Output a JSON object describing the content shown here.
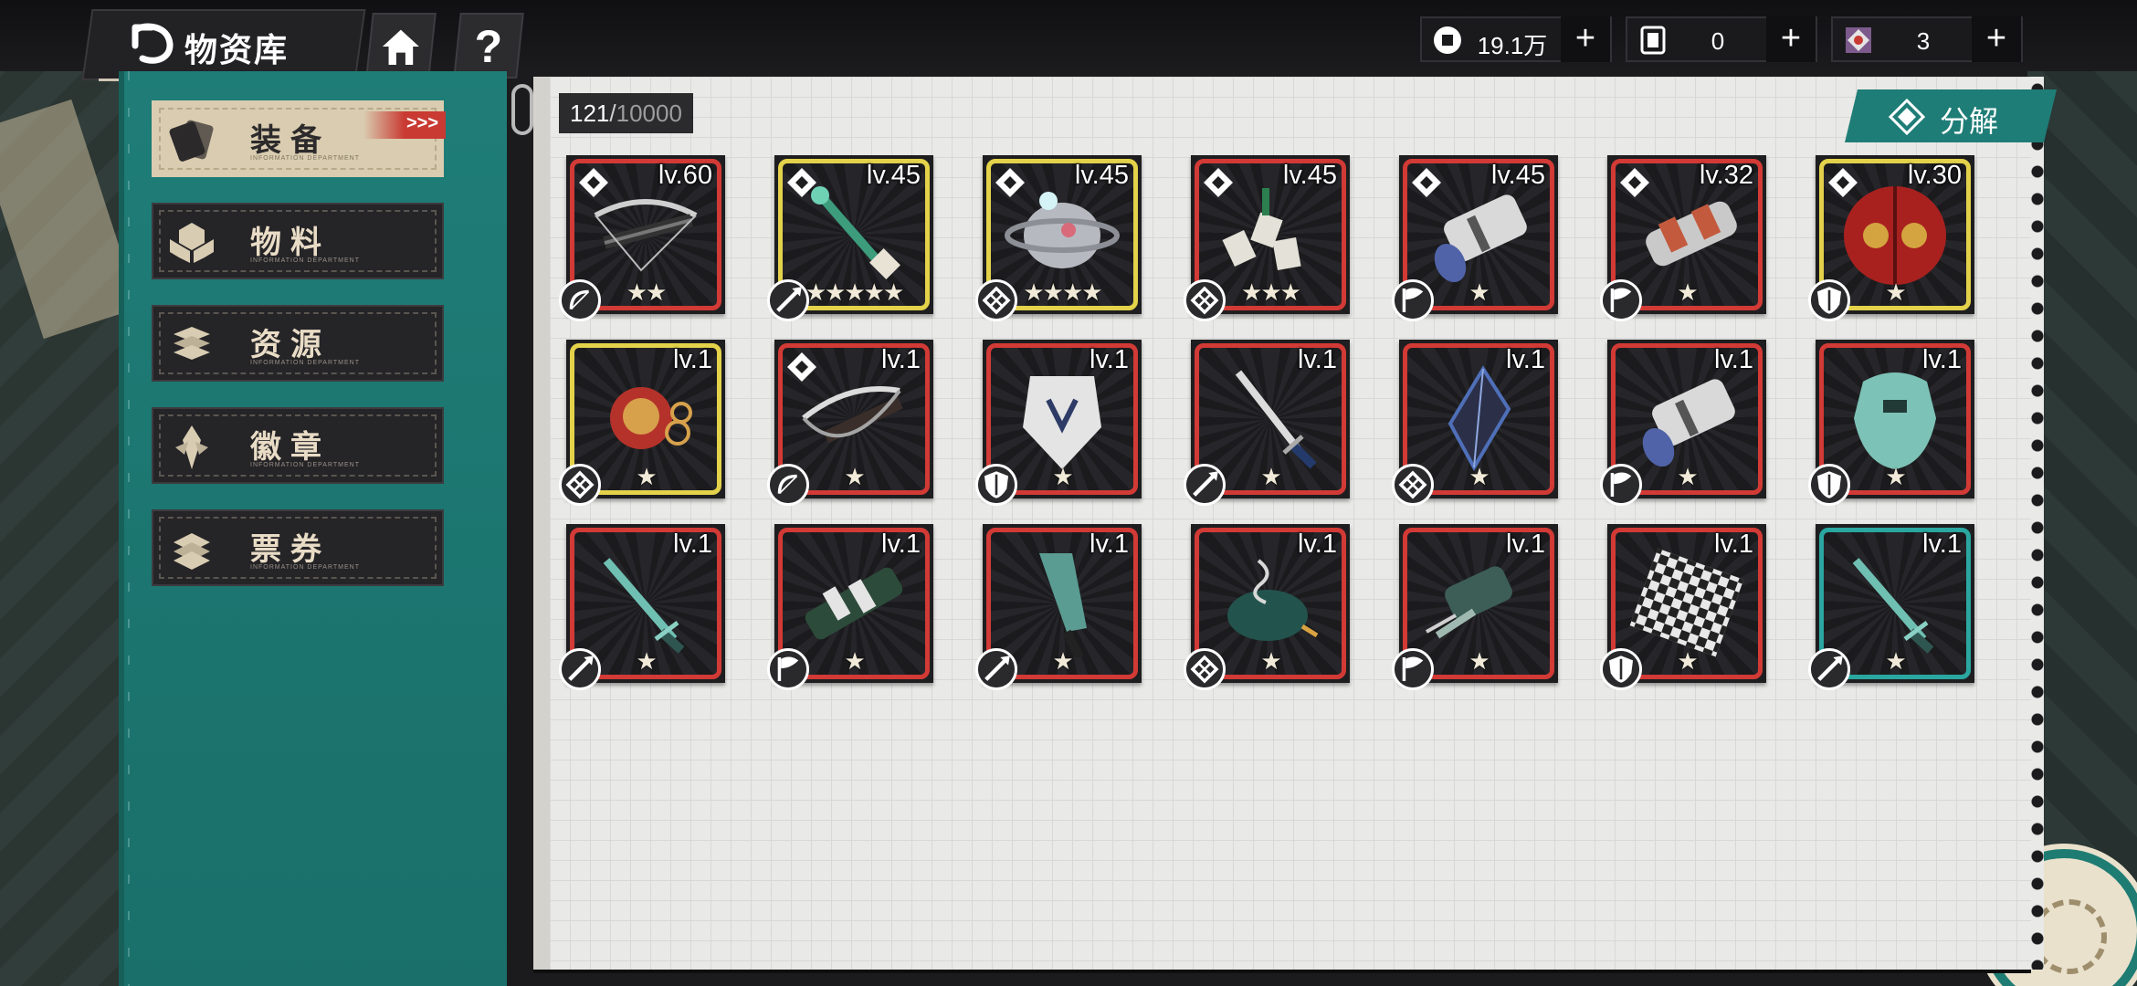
{
  "header": {
    "title": "物资库",
    "icons": {
      "back": "back-arrow-icon",
      "home": "home-icon",
      "help": "question-mark-icon"
    }
  },
  "currencies": [
    {
      "name": "coin",
      "icon": "coin-icon",
      "value": "19.1万",
      "plus": "+"
    },
    {
      "name": "ticket",
      "icon": "card-icon",
      "value": "0",
      "plus": "+"
    },
    {
      "name": "gem",
      "icon": "gem-icon",
      "value": "3",
      "plus": "+"
    }
  ],
  "sidebar": {
    "items": [
      {
        "label": "装备",
        "sub": "INFORMATION DEPARTMENT",
        "icon": "equipment-icon",
        "active": true,
        "flag": ">>>"
      },
      {
        "label": "物料",
        "sub": "INFORMATION DEPARTMENT",
        "icon": "materials-icon",
        "active": false
      },
      {
        "label": "资源",
        "sub": "INFORMATION DEPARTMENT",
        "icon": "resources-icon",
        "active": false
      },
      {
        "label": "徽章",
        "sub": "INFORMATION DEPARTMENT",
        "icon": "badge-icon",
        "active": false
      },
      {
        "label": "票券",
        "sub": "INFORMATION DEPARTMENT",
        "icon": "tickets-icon",
        "active": false
      }
    ]
  },
  "inventory": {
    "count": "121",
    "separator": "/",
    "max": "10000",
    "decompose_label": "分解",
    "decompose_icon": "decompose-icon"
  },
  "items": [
    {
      "level": "lv.60",
      "stars": "★★",
      "rarity": "#d23a36",
      "type": "bow-icon",
      "sprite": "crossbow",
      "badge": true
    },
    {
      "level": "lv.45",
      "stars": "★★★★★",
      "rarity": "#e3d24a",
      "type": "spear-icon",
      "sprite": "staff",
      "badge": true
    },
    {
      "level": "lv.45",
      "stars": "★★★★",
      "rarity": "#e3d24a",
      "type": "knot-icon",
      "sprite": "orb",
      "badge": true
    },
    {
      "level": "lv.45",
      "stars": "★★★",
      "rarity": "#d23a36",
      "type": "knot-icon",
      "sprite": "mahjong",
      "badge": true
    },
    {
      "level": "lv.45",
      "stars": "★",
      "rarity": "#d23a36",
      "type": "flag-icon",
      "sprite": "cannon",
      "badge": true
    },
    {
      "level": "lv.32",
      "stars": "★",
      "rarity": "#d23a36",
      "type": "flag-icon",
      "sprite": "rocket",
      "badge": true
    },
    {
      "level": "lv.30",
      "stars": "★",
      "rarity": "#e3d24a",
      "type": "shield-icon",
      "sprite": "door-shield",
      "badge": true
    },
    {
      "level": "lv.1",
      "stars": "★",
      "rarity": "#e3d24a",
      "type": "knot-icon",
      "sprite": "lion-ring",
      "badge": false
    },
    {
      "level": "lv.1",
      "stars": "★",
      "rarity": "#d23a36",
      "type": "bow-icon",
      "sprite": "crossbow2",
      "badge": true
    },
    {
      "level": "lv.1",
      "stars": "★",
      "rarity": "#d23a36",
      "type": "shield-icon",
      "sprite": "plate-shield",
      "badge": false
    },
    {
      "level": "lv.1",
      "stars": "★",
      "rarity": "#d23a36",
      "type": "spear-icon",
      "sprite": "sword",
      "badge": false
    },
    {
      "level": "lv.1",
      "stars": "★",
      "rarity": "#d23a36",
      "type": "knot-icon",
      "sprite": "diamond",
      "badge": false
    },
    {
      "level": "lv.1",
      "stars": "★",
      "rarity": "#d23a36",
      "type": "flag-icon",
      "sprite": "cannon",
      "badge": false
    },
    {
      "level": "lv.1",
      "stars": "★",
      "rarity": "#d23a36",
      "type": "shield-icon",
      "sprite": "jade-shield",
      "badge": false
    },
    {
      "level": "lv.1",
      "stars": "★",
      "rarity": "#d23a36",
      "type": "spear-icon",
      "sprite": "jade-sword",
      "badge": false
    },
    {
      "level": "lv.1",
      "stars": "★",
      "rarity": "#d23a36",
      "type": "flag-icon",
      "sprite": "tube",
      "badge": false
    },
    {
      "level": "lv.1",
      "stars": "★",
      "rarity": "#d23a36",
      "type": "spear-icon",
      "sprite": "machete",
      "badge": false
    },
    {
      "level": "lv.1",
      "stars": "★",
      "rarity": "#d23a36",
      "type": "knot-icon",
      "sprite": "censer",
      "badge": false
    },
    {
      "level": "lv.1",
      "stars": "★",
      "rarity": "#d23a36",
      "type": "flag-icon",
      "sprite": "gun",
      "badge": false
    },
    {
      "level": "lv.1",
      "stars": "★",
      "rarity": "#d23a36",
      "type": "shield-icon",
      "sprite": "checker",
      "badge": false
    },
    {
      "level": "lv.1",
      "stars": "★",
      "rarity": "#2aa7a0",
      "type": "spear-icon",
      "sprite": "jade-sword",
      "badge": false
    }
  ],
  "colors": {
    "accent_teal": "#1f7d77",
    "rarity_red": "#d23a36",
    "rarity_gold": "#e3d24a",
    "rarity_teal": "#2aa7a0"
  }
}
